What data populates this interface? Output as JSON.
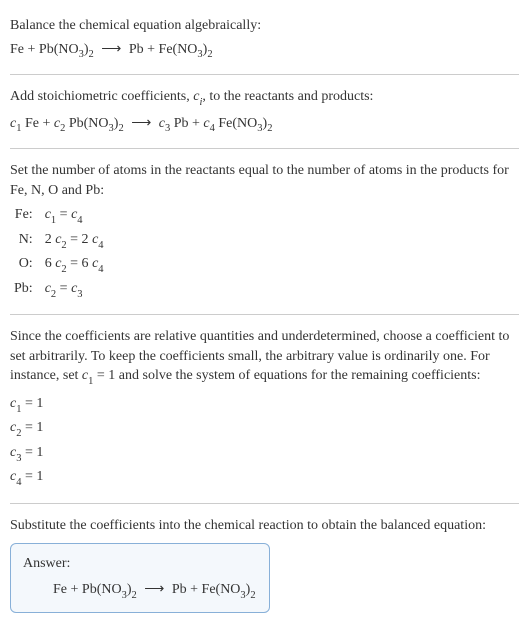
{
  "title": "Balance the chemical equation algebraically:",
  "eqn_initial": {
    "r1": "Fe",
    "plus1": " + ",
    "r2": "Pb(NO",
    "r2sub1": "3",
    "r2mid": ")",
    "r2sub2": "2",
    "arrow": " ⟶ ",
    "p1": "Pb",
    "plus2": " + ",
    "p2": "Fe(NO",
    "p2sub1": "3",
    "p2mid": ")",
    "p2sub2": "2"
  },
  "step2_text": "Add stoichiometric coefficients, ",
  "step2_ci": "c",
  "step2_ci_sub": "i",
  "step2_text2": ", to the reactants and products:",
  "eqn_coeff": {
    "c1": "c",
    "c1s": "1",
    "sp1": " Fe + ",
    "c2": "c",
    "c2s": "2",
    "sp2": " Pb(NO",
    "sp2sub1": "3",
    "sp2mid": ")",
    "sp2sub2": "2",
    "arrow": " ⟶ ",
    "c3": "c",
    "c3s": "3",
    "sp3": " Pb + ",
    "c4": "c",
    "c4s": "4",
    "sp4": " Fe(NO",
    "sp4sub1": "3",
    "sp4mid": ")",
    "sp4sub2": "2"
  },
  "step3_text": "Set the number of atoms in the reactants equal to the number of atoms in the products for Fe, N, O and Pb:",
  "atoms": [
    {
      "el": "Fe:",
      "lhs_pre": "",
      "lhs_c": "c",
      "lhs_s": "1",
      "eq": " = ",
      "rhs_pre": "",
      "rhs_c": "c",
      "rhs_s": "4"
    },
    {
      "el": "N:",
      "lhs_pre": "2 ",
      "lhs_c": "c",
      "lhs_s": "2",
      "eq": " = 2 ",
      "rhs_pre": "",
      "rhs_c": "c",
      "rhs_s": "4"
    },
    {
      "el": "O:",
      "lhs_pre": "6 ",
      "lhs_c": "c",
      "lhs_s": "2",
      "eq": " = 6 ",
      "rhs_pre": "",
      "rhs_c": "c",
      "rhs_s": "4"
    },
    {
      "el": "Pb:",
      "lhs_pre": "",
      "lhs_c": "c",
      "lhs_s": "2",
      "eq": " = ",
      "rhs_pre": "",
      "rhs_c": "c",
      "rhs_s": "3"
    }
  ],
  "step4_text_a": "Since the coefficients are relative quantities and underdetermined, choose a coefficient to set arbitrarily. To keep the coefficients small, the arbitrary value is ordinarily one. For instance, set ",
  "step4_c": "c",
  "step4_cs": "1",
  "step4_text_b": " = 1 and solve the system of equations for the remaining coefficients:",
  "solutions": [
    {
      "c": "c",
      "s": "1",
      "eq": " = 1"
    },
    {
      "c": "c",
      "s": "2",
      "eq": " = 1"
    },
    {
      "c": "c",
      "s": "3",
      "eq": " = 1"
    },
    {
      "c": "c",
      "s": "4",
      "eq": " = 1"
    }
  ],
  "step5_text": "Substitute the coefficients into the chemical reaction to obtain the balanced equation:",
  "answer_label": "Answer:",
  "eqn_final": {
    "r1": "Fe",
    "plus1": " + ",
    "r2": "Pb(NO",
    "r2sub1": "3",
    "r2mid": ")",
    "r2sub2": "2",
    "arrow": " ⟶ ",
    "p1": "Pb",
    "plus2": " + ",
    "p2": "Fe(NO",
    "p2sub1": "3",
    "p2mid": ")",
    "p2sub2": "2"
  }
}
